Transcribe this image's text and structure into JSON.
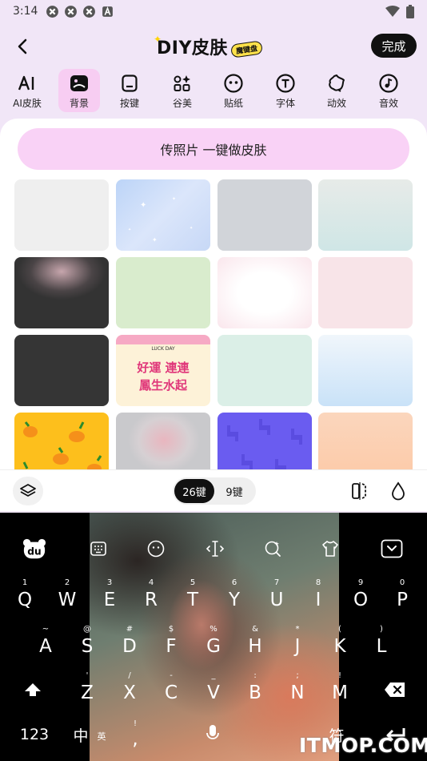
{
  "status_bar": {
    "time": "3:14"
  },
  "header": {
    "title": "DIY皮肤",
    "badge": "魔键盘",
    "done_label": "完成"
  },
  "tabs": [
    {
      "label": "AI皮肤",
      "icon": "ai-icon"
    },
    {
      "label": "背景",
      "icon": "image-icon"
    },
    {
      "label": "按键",
      "icon": "key-icon"
    },
    {
      "label": "谷美",
      "icon": "apps-sparkle-icon"
    },
    {
      "label": "贴纸",
      "icon": "sticker-icon"
    },
    {
      "label": "字体",
      "icon": "font-icon"
    },
    {
      "label": "动效",
      "icon": "effect-icon"
    },
    {
      "label": "音效",
      "icon": "music-icon"
    }
  ],
  "active_tab": "背景",
  "upload_label": "传照片 一键做皮肤",
  "backgrounds": [
    {
      "name": "light-gray"
    },
    {
      "name": "blue-sparkle"
    },
    {
      "name": "gray"
    },
    {
      "name": "mint-gradient"
    },
    {
      "name": "dark-glow"
    },
    {
      "name": "light-green"
    },
    {
      "name": "white-pink-glow"
    },
    {
      "name": "light-pink"
    },
    {
      "name": "dark-gray"
    },
    {
      "name": "lucky-day-sticker",
      "text": "LUCK DAY",
      "text2": "好運 連連",
      "text3": "鳳生水起"
    },
    {
      "name": "pale-mint"
    },
    {
      "name": "sky-gradient"
    },
    {
      "name": "mango-yellow"
    },
    {
      "name": "gray-pink-blur"
    },
    {
      "name": "blue-alpaca"
    },
    {
      "name": "peach"
    }
  ],
  "kb_toolbar": {
    "mode_26": "26键",
    "mode_9": "9键"
  },
  "keyboard": {
    "row1": [
      {
        "key": "Q",
        "hint": "1"
      },
      {
        "key": "W",
        "hint": "2"
      },
      {
        "key": "E",
        "hint": "3"
      },
      {
        "key": "R",
        "hint": "4"
      },
      {
        "key": "T",
        "hint": "5"
      },
      {
        "key": "Y",
        "hint": "6"
      },
      {
        "key": "U",
        "hint": "7"
      },
      {
        "key": "I",
        "hint": "8"
      },
      {
        "key": "O",
        "hint": "9"
      },
      {
        "key": "P",
        "hint": "0"
      }
    ],
    "row2": [
      {
        "key": "A",
        "hint": "~"
      },
      {
        "key": "S",
        "hint": "@"
      },
      {
        "key": "D",
        "hint": "#"
      },
      {
        "key": "F",
        "hint": "$"
      },
      {
        "key": "G",
        "hint": "%"
      },
      {
        "key": "H",
        "hint": "&"
      },
      {
        "key": "J",
        "hint": "*"
      },
      {
        "key": "K",
        "hint": "("
      },
      {
        "key": "L",
        "hint": ")"
      }
    ],
    "row3": [
      {
        "key": "Z",
        "hint": "'"
      },
      {
        "key": "X",
        "hint": "/"
      },
      {
        "key": "C",
        "hint": "-"
      },
      {
        "key": "V",
        "hint": "_"
      },
      {
        "key": "B",
        "hint": ":"
      },
      {
        "key": "N",
        "hint": ";"
      },
      {
        "key": "M",
        "hint": "!"
      }
    ],
    "num_key": "123",
    "lang_key": "中",
    "lang_sub": "英",
    "comma_key": ",",
    "comma_hint": "!",
    "symbol_key": "符",
    "watermark": "ITMOP.COM"
  }
}
